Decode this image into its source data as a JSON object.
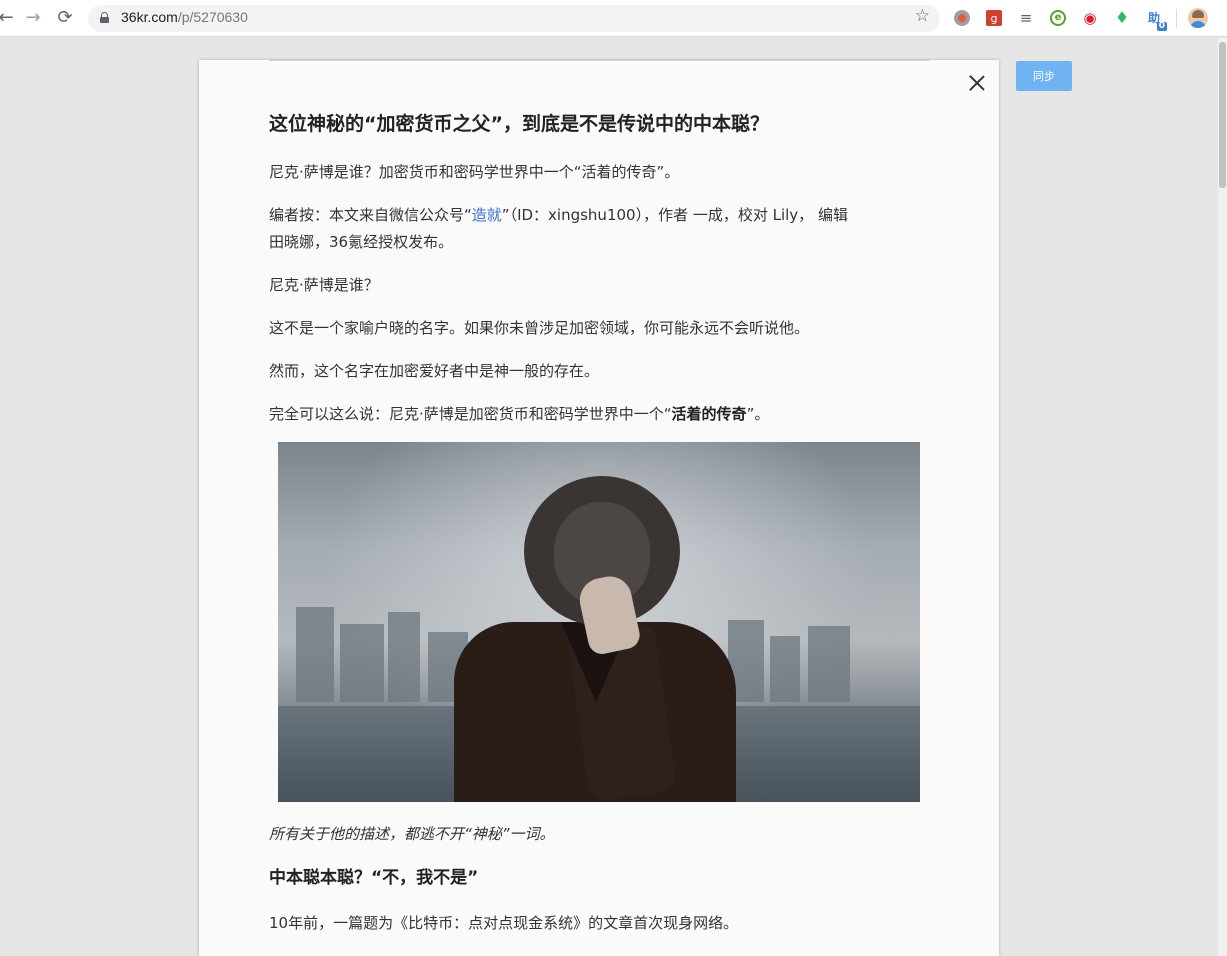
{
  "browser": {
    "url_host": "36kr.com",
    "url_path": "/p/5270630",
    "back_glyph": "←",
    "forward_glyph": "→",
    "reload_glyph": "⟳",
    "star_glyph": "☆",
    "extensions": [
      {
        "name": "record-extension-icon",
        "glyph": "●",
        "color": "#c0392b"
      },
      {
        "name": "g-extension-icon",
        "glyph": "g",
        "color": "#d23f31"
      },
      {
        "name": "reader-extension-icon",
        "glyph": "≡",
        "color": "#5f6368"
      },
      {
        "name": "e-extension-icon",
        "glyph": "e",
        "color": "#5aa025"
      },
      {
        "name": "weibo-extension-icon",
        "glyph": "◉",
        "color": "#e6162d"
      },
      {
        "name": "evernote-extension-icon",
        "glyph": "♦",
        "color": "#2dbe60"
      },
      {
        "name": "translate-extension-icon",
        "glyph": "助",
        "color": "#3b82d9",
        "badge": "0"
      }
    ]
  },
  "sync_button": "同步",
  "article": {
    "title": "这位神秘的“加密货币之父”，到底是不是传说中的中本聪？",
    "p1": "尼克·萨博是谁？加密货币和密码学世界中一个“活着的传奇”。",
    "editor_note_line1_a": "编者按：本文来自微信公众号“",
    "editor_note_link": "造就",
    "editor_note_line1_b": "”（ID：xingshu100），作者 一成，校对 Lily， 编辑",
    "editor_note_line2": "田晓娜，36氪经授权发布。",
    "p2": "尼克·萨博是谁？",
    "p3": "这不是一个家喻户晓的名字。如果你未曾涉足加密领域，你可能永远不会听说他。",
    "p4": "然而，这个名字在加密爱好者中是神一般的存在。",
    "p5_a": "完全可以这么说：尼克·萨博是加密货币和密码学世界中一个“",
    "p5_bold": "活着的传奇",
    "p5_b": "”。",
    "caption": "所有关于他的描述，都逃不开“神秘”一词。",
    "subheading": "中本聪本聪？“不，我不是”",
    "p6": "10年前，一篇题为《比特币：点对点现金系统》的文章首次现身网络。"
  }
}
